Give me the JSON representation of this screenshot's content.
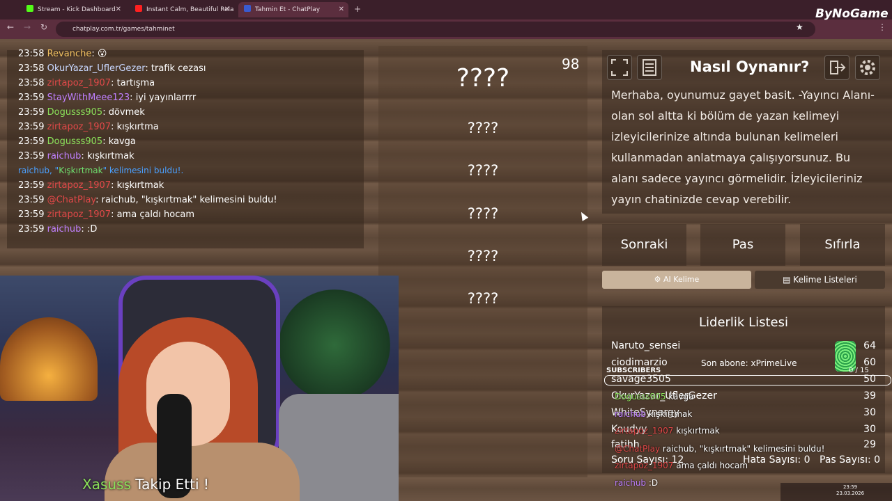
{
  "browser": {
    "tabs": [
      {
        "title": "Stream - Kick Dashboard",
        "color": "#53fc18"
      },
      {
        "title": "Instant Calm, Beautiful Rela",
        "color": "#ff2020"
      },
      {
        "title": "Tahmin Et - ChatPlay",
        "color": "#3a5bd0"
      }
    ],
    "url": "chatplay.com.tr/games/tahminet"
  },
  "chat": {
    "lines": [
      {
        "time": "23:58",
        "user": "Revanche",
        "msg": "😮",
        "color": "u-gold"
      },
      {
        "time": "23:58",
        "user": "OkurYazar_UflerGezer",
        "msg": "trafik cezası",
        "color": "u-blue"
      },
      {
        "time": "23:58",
        "user": "zirtapoz_1907",
        "msg": "tartışma",
        "color": "u-red"
      },
      {
        "time": "23:59",
        "user": "StayWithMeee123",
        "msg": "iyi yayınlarrrr",
        "color": "u-purple"
      },
      {
        "time": "23:59",
        "user": "Dogusss905",
        "msg": "dövmek",
        "color": "u-green"
      },
      {
        "time": "23:59",
        "user": "zirtapoz_1907",
        "msg": "kışkırtma",
        "color": "u-red"
      },
      {
        "time": "23:59",
        "user": "Dogusss905",
        "msg": "kavga",
        "color": "u-green"
      },
      {
        "time": "23:59",
        "user": "raichub",
        "msg": "kışkırtmak",
        "color": "u-purple"
      },
      {
        "time": "",
        "user": "",
        "msg": "",
        "color": ""
      },
      {
        "time": "23:59",
        "user": "zirtapoz_1907",
        "msg": "kışkırtmak",
        "color": "u-red"
      },
      {
        "time": "23:59",
        "user": "@ChatPlay",
        "msg": "raichub, \"kışkırtmak\" kelimesini buldu!",
        "color": "u-red"
      },
      {
        "time": "23:59",
        "user": "zirtapoz_1907",
        "msg": "ama çaldı hocam",
        "color": "u-red"
      },
      {
        "time": "23:59",
        "user": "raichub",
        "msg": ":D",
        "color": "u-purple"
      }
    ],
    "system": {
      "prefix": "raichub, \"",
      "word": "Kışkırtmak",
      "suffix": "\" kelimesini buldu!."
    }
  },
  "game": {
    "counter": "98",
    "words": [
      "????",
      "????",
      "????",
      "????",
      "????",
      "????"
    ],
    "howto_title": "Nasıl Oynanır?",
    "howto_text": "Merhaba, oyunumuz gayet basit. -Yayıncı Alanı- olan sol altta ki bölüm de yazan kelimeyi izleyicilerinize altında bulunan kelimeleri kullanmadan anlatmaya çalışıyorsunuz. Bu alanı sadece yayıncı görmelidir. İzleyicileriniz yayın chatinizde cevap verebilir.",
    "buttons": {
      "next": "Sonraki",
      "pass": "Pas",
      "reset": "Sıfırla"
    },
    "ai_word": "AI Kelime",
    "word_lists": "Kelime Listeleri",
    "leaderboard": {
      "title": "Liderlik Listesi",
      "rows": [
        {
          "name": "Naruto_sensei",
          "score": "64"
        },
        {
          "name": "ciodimarzio",
          "score": "60"
        },
        {
          "name": "savage3505",
          "score": "50"
        },
        {
          "name": "OkurYazar_UflerGezer",
          "score": "39"
        },
        {
          "name": "WhiteSynergy",
          "score": "30"
        },
        {
          "name": "Koudyy",
          "score": "30"
        },
        {
          "name": "fatihh",
          "score": "29"
        }
      ]
    },
    "footer": {
      "questions": "Soru Sayısı: 12",
      "errors": "Hata Sayısı: 0",
      "passes": "Pas Sayısı: 0"
    }
  },
  "overlay": {
    "brand": "ByNoGame",
    "subscribers_label": "SUBSCRIBERS",
    "subscribers_count": "0 / 15",
    "last_sub": "Son abone: xPrimeLive",
    "follow_name": "Xasuss",
    "follow_text": " Takip Etti !",
    "ovchat": [
      {
        "user": "Dogusss905",
        "msg": "kavga"
      },
      {
        "user": "raichub",
        "msg": "kışkırtmak"
      },
      {
        "user": "zirtapoz_1907",
        "msg": "kışkırtmak"
      },
      {
        "user": "@ChatPlay",
        "msg": "raichub, \"kışkırtmak\" kelimesini buldu!"
      },
      {
        "user": "zirtapoz_1907",
        "msg": "ama çaldı hocam"
      },
      {
        "user": "raichub",
        "msg": ":D"
      }
    ],
    "clock_time": "23:59",
    "clock_date": "23.03.2026"
  }
}
